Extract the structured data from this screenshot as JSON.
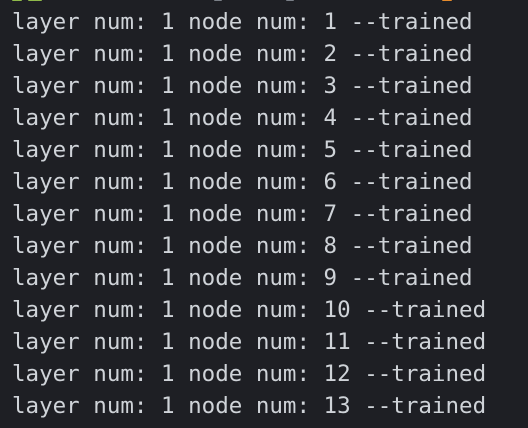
{
  "terminal": {
    "colors": {
      "background": "#1e1f24",
      "text": "#cfd3d8",
      "accent_green": "#8fb94a",
      "accent_orange": "#e58a2c"
    },
    "lines": [
      "layer num: 1 node num: 1 --trained",
      "layer num: 1 node num: 2 --trained",
      "layer num: 1 node num: 3 --trained",
      "layer num: 1 node num: 4 --trained",
      "layer num: 1 node num: 5 --trained",
      "layer num: 1 node num: 6 --trained",
      "layer num: 1 node num: 7 --trained",
      "layer num: 1 node num: 8 --trained",
      "layer num: 1 node num: 9 --trained",
      "layer num: 1 node num: 10 --trained",
      "layer num: 1 node num: 11 --trained",
      "layer num: 1 node num: 12 --trained",
      "layer num: 1 node num: 13 --trained"
    ]
  }
}
